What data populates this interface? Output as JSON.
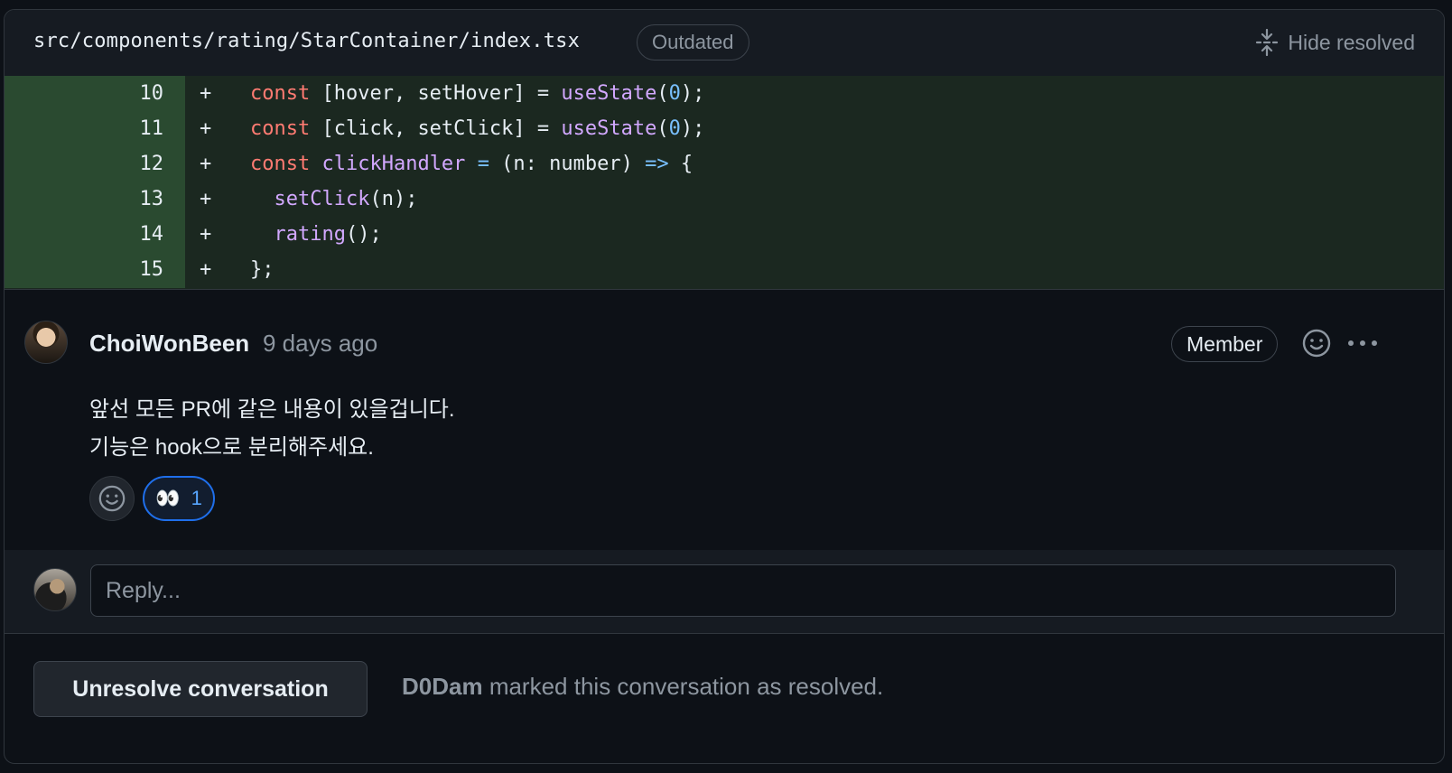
{
  "header": {
    "file_path": "src/components/rating/StarContainer/index.tsx",
    "status_badge": "Outdated",
    "hide_resolved_label": "Hide resolved"
  },
  "diff": {
    "lines": [
      {
        "number": "10",
        "marker": "+",
        "code": "const [hover, setHover] = useState(0);"
      },
      {
        "number": "11",
        "marker": "+",
        "code": "const [click, setClick] = useState(0);"
      },
      {
        "number": "12",
        "marker": "+",
        "code": "const clickHandler = (n: number) => {"
      },
      {
        "number": "13",
        "marker": "+",
        "code": "  setClick(n);"
      },
      {
        "number": "14",
        "marker": "+",
        "code": "  rating();"
      },
      {
        "number": "15",
        "marker": "+",
        "code": "};"
      }
    ]
  },
  "comment": {
    "author": "ChoiWonBeen",
    "timestamp": "9 days ago",
    "role_badge": "Member",
    "body_lines": [
      "앞선 모든 PR에 같은 내용이 있을겁니다.",
      "기능은 hook으로 분리해주세요."
    ],
    "reactions": [
      {
        "emoji": "👀",
        "count": "1"
      }
    ]
  },
  "reply": {
    "placeholder": "Reply..."
  },
  "footer": {
    "unresolve_label": "Unresolve conversation",
    "resolved_by": "D0Dam",
    "resolved_text": " marked this conversation as resolved."
  },
  "colors": {
    "background": "#0d1117",
    "added_line_bg": "#1b2820",
    "added_gutter_bg": "#2a4a30",
    "keyword": "#ff7b72",
    "function": "#d2a8ff",
    "number": "#79c0ff",
    "accent_blue": "#1f6feb",
    "muted_text": "#8d96a0"
  }
}
